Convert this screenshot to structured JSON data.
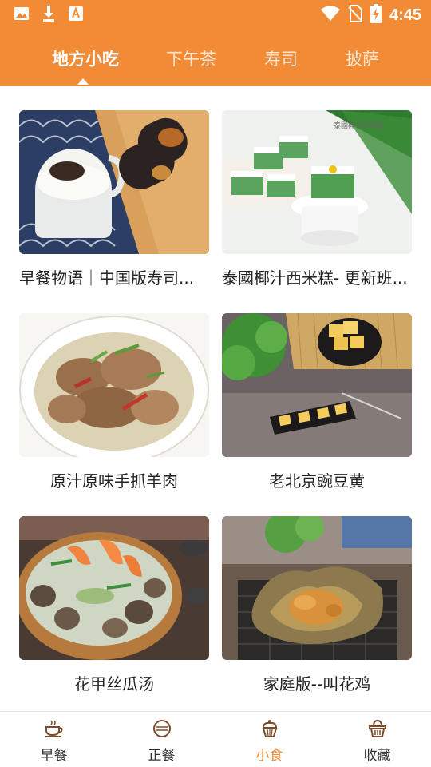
{
  "status_bar": {
    "time": "4:45",
    "left_icons": [
      "image-icon",
      "download-icon",
      "font-icon"
    ],
    "right_icons": [
      "wifi-icon",
      "no-sim-icon",
      "battery-charging-icon"
    ]
  },
  "tabs": [
    {
      "label": "地方小吃",
      "active": true
    },
    {
      "label": "下午茶",
      "active": false
    },
    {
      "label": "寿司",
      "active": false
    },
    {
      "label": "披萨",
      "active": false
    }
  ],
  "cards": [
    {
      "title": "早餐物语｜中国版寿司...",
      "image": "breakfast-sushi-photo"
    },
    {
      "title": "泰國椰汁西米糕- 更新班...",
      "image": "coconut-sago-cake-photo"
    },
    {
      "title": "原汁原味手抓羊肉",
      "image": "hand-pulled-mutton-photo"
    },
    {
      "title": "老北京豌豆黄",
      "image": "pea-cake-photo"
    },
    {
      "title": "花甲丝瓜汤",
      "image": "clam-loofah-soup-photo"
    },
    {
      "title": "家庭版--叫花鸡",
      "image": "beggars-chicken-photo"
    }
  ],
  "bottom_nav": [
    {
      "label": "早餐",
      "icon": "coffee-cup-icon",
      "active": false
    },
    {
      "label": "正餐",
      "icon": "bowl-icon",
      "active": false
    },
    {
      "label": "小食",
      "icon": "cupcake-icon",
      "active": true
    },
    {
      "label": "收藏",
      "icon": "basket-icon",
      "active": false
    }
  ],
  "colors": {
    "accent": "#F18B35",
    "text": "#222222",
    "nav_text": "#333333"
  }
}
